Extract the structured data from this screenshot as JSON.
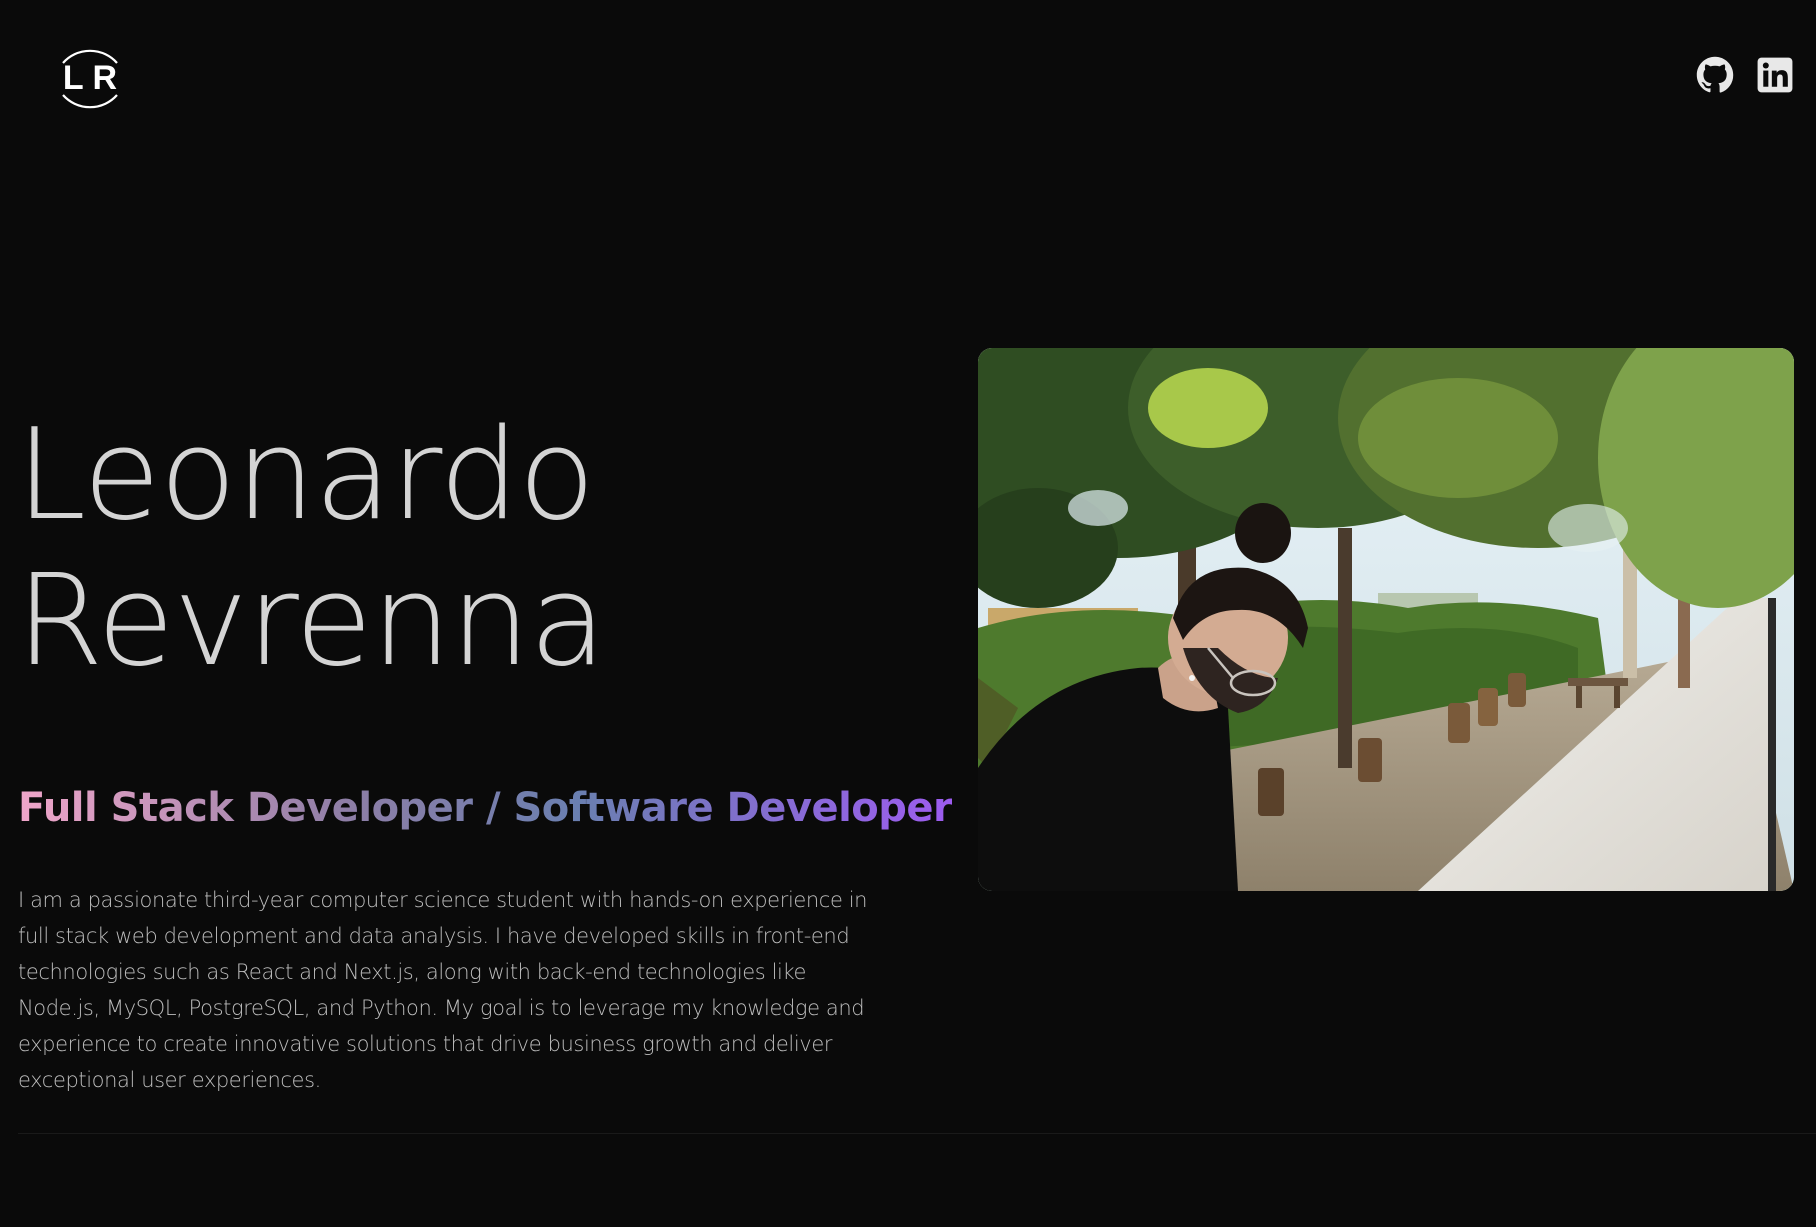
{
  "header": {
    "logo_text": "L R",
    "social": [
      {
        "name": "GitHub",
        "icon": "github-icon"
      },
      {
        "name": "LinkedIn",
        "icon": "linkedin-icon"
      }
    ]
  },
  "hero": {
    "first_name": "Leonardo",
    "last_name": "Revrenna",
    "role": "Full Stack Developer / Software Developer",
    "bio": "I am a passionate third-year computer science student with hands-on experience in full stack web development and data analysis. I have developed skills in front-end technologies such as React and Next.js, along with back-end technologies like Node.js, MySQL, PostgreSQL, and Python. My goal is to leverage my knowledge and experience to create innovative solutions that drive business growth and deliver exceptional user experiences."
  },
  "photo": {
    "subject": "portrait-photo"
  },
  "colors": {
    "background": "#0a0a0a",
    "name_text": "#d4d4d4",
    "bio_text": "#bdbdbd",
    "role_gradient_start": "#f0a6ca",
    "role_gradient_end": "#9d5cf0"
  }
}
